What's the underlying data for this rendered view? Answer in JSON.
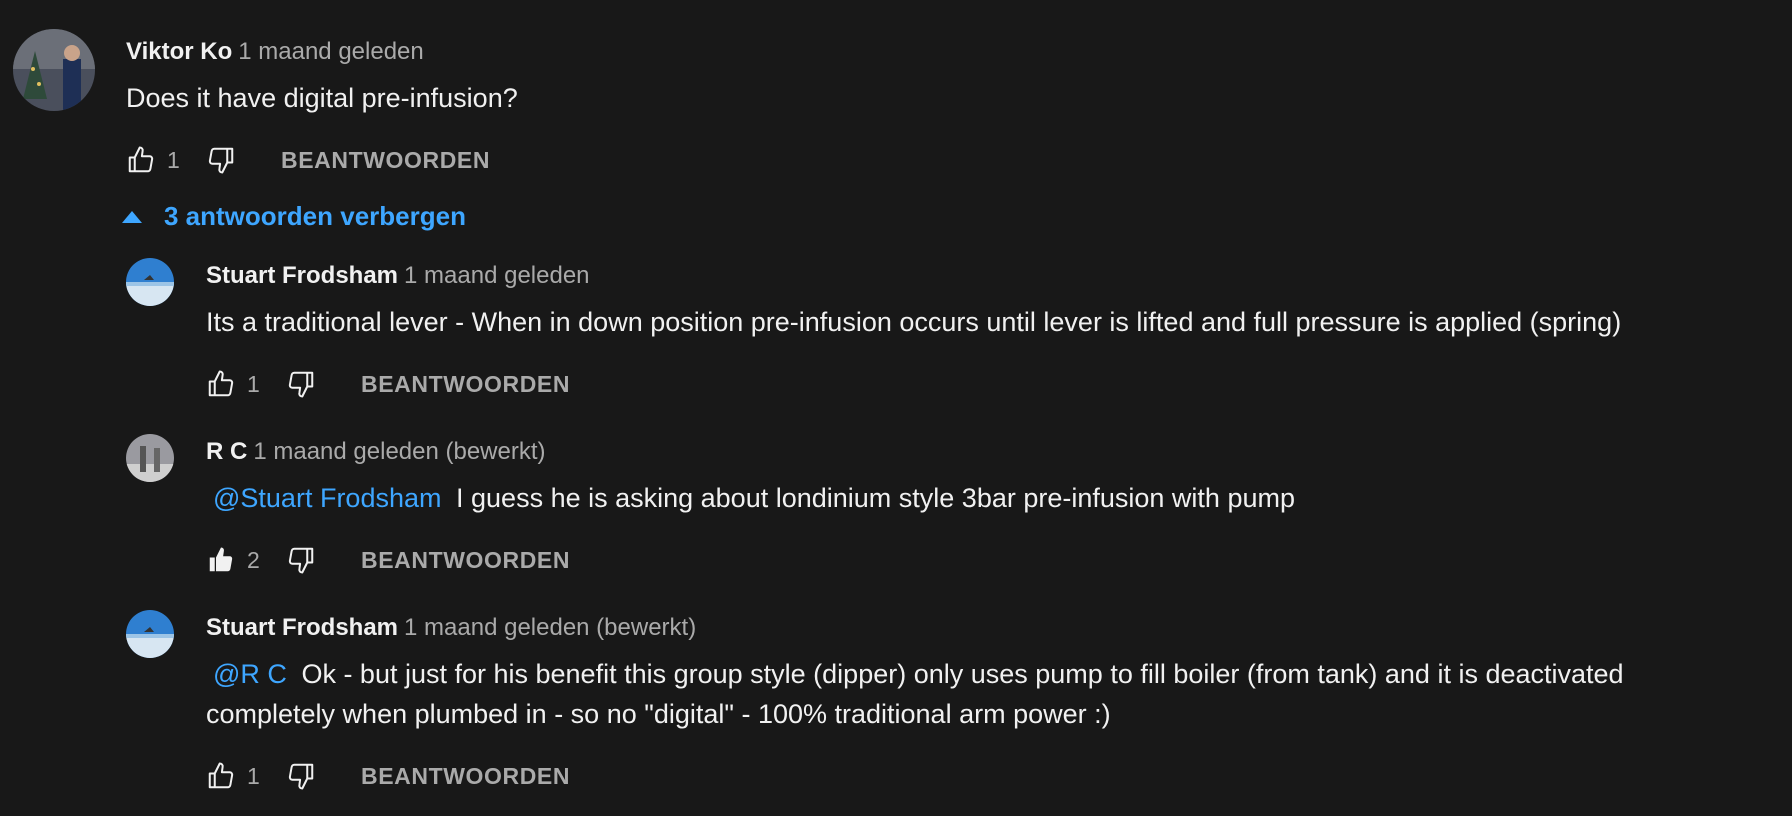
{
  "comments": [
    {
      "author": "Viktor Ko",
      "time": "1 maand geleden",
      "mention": "",
      "text": "Does it have digital pre-infusion?",
      "likes": "1",
      "reply_label": "BEANTWOORDEN"
    },
    {
      "author": "Stuart Frodsham",
      "time": "1 maand geleden",
      "mention": "",
      "text": "Its a traditional lever - When in down position pre-infusion occurs until lever is lifted and full pressure is applied (spring)",
      "likes": "1",
      "reply_label": "BEANTWOORDEN"
    },
    {
      "author": "R C",
      "time": "1 maand geleden (bewerkt)",
      "mention": "@Stuart Frodsham",
      "text": "I guess he is asking about londinium style 3bar pre-infusion with pump",
      "likes": "2",
      "liked": true,
      "reply_label": "BEANTWOORDEN"
    },
    {
      "author": "Stuart Frodsham",
      "time": "1 maand geleden (bewerkt)",
      "mention": "@R C",
      "text": "Ok - but just for his benefit this group style (dipper) only uses pump to fill boiler (from tank) and it is deactivated completely when plumbed in - so no \"digital\" - 100% traditional arm power :)",
      "likes": "1",
      "reply_label": "BEANTWOORDEN"
    }
  ],
  "replies_toggle": {
    "label": "3 antwoorden verbergen",
    "icon": "caret-up-icon"
  },
  "colors": {
    "background": "#181818",
    "accent": "#3ea6ff",
    "secondary_text": "#aaaaaa"
  }
}
